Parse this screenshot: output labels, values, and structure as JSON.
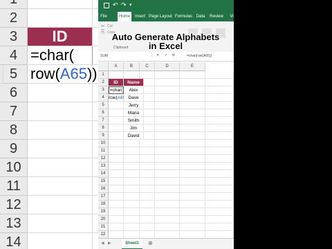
{
  "overlay_title": [
    "Auto Generate Alphabets",
    "in Excel"
  ],
  "background_sheet": {
    "rows": [
      "1",
      "2",
      "3",
      "4",
      "5",
      "6",
      "7",
      "8",
      "9",
      "10",
      "11",
      "12",
      "13",
      "14"
    ],
    "id_label": "ID",
    "formula_parts": [
      "=char(",
      "row(",
      "A65",
      "))"
    ]
  },
  "excel": {
    "tabs": [
      "File",
      "Home",
      "Insert",
      "Page Layout",
      "Formulas",
      "Data",
      "Review",
      "Vi"
    ],
    "active_tab": "Home",
    "ribbon": {
      "cut": "Cut",
      "copy": "Copy",
      "clipboard": "Clipboard"
    },
    "name_box": "SUM",
    "formula_bar": "=char(row(A65))",
    "columns": [
      "A",
      "B",
      "C",
      "D",
      "E"
    ],
    "rows": [
      "1",
      "2",
      "3",
      "4",
      "5",
      "6",
      "7",
      "8",
      "9",
      "10",
      "11",
      "12",
      "13",
      "14",
      "15",
      "16",
      "17",
      "18",
      "19",
      "20",
      "21",
      "22"
    ],
    "table": {
      "header_id": "ID",
      "header_name": "Name",
      "formula_line1": "=char(",
      "formula_line2_parts": [
        "row(",
        "A65",
        "))"
      ],
      "names": [
        "Alex",
        "Dave",
        "Jerry",
        "Maria",
        "Smith",
        "Jim",
        "David"
      ]
    },
    "sheet_tab": "Sheet1"
  }
}
